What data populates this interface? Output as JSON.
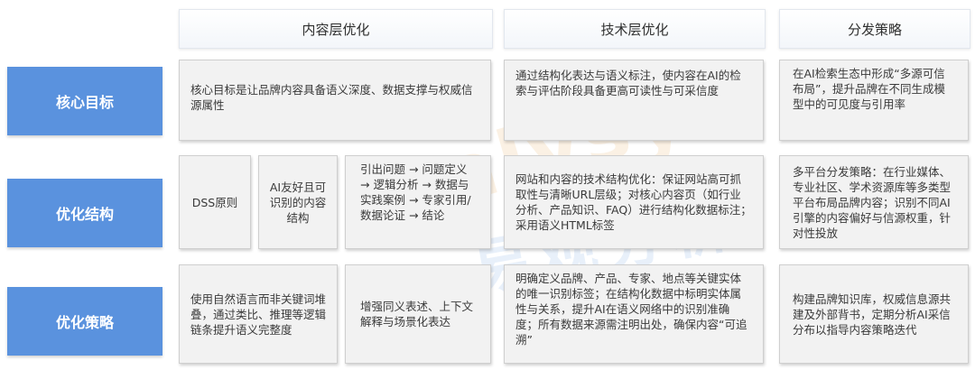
{
  "headers": [
    "内容层优化",
    "技术层优化",
    "分发策略"
  ],
  "rows": [
    {
      "label": "核心目标",
      "content": "核心目标是让品牌内容具备语义深度、数据支撑与权威信源属性",
      "tech": "通过结构化表达与语义标注，使内容在AI的检索与评估阶段具备更高可读性与可采信度",
      "dist": "在AI检索生态中形成“多源可信布局”，提升品牌在不同生成模型中的可见度与引用率"
    },
    {
      "label": "优化结构",
      "content_parts": [
        "DSS原则",
        "AI友好且可识别的内容结构",
        "引出问题 → 问题定义 → 逻辑分析 → 数据与实践案例 → 专家引用/数据论证 → 结论"
      ],
      "tech": "网站和内容的技术结构优化：保证网站高可抓取性与清晰URL层级；对核心内容页（如行业分析、产品知识、FAQ）进行结构化数据标注；采用语义HTML标签",
      "dist": "多平台分发策略：在行业媒体、专业社区、学术资源库等多类型平台布局品牌内容；识别不同AI引擎的内容偏好与信源权重，针对性投放"
    },
    {
      "label": "优化策略",
      "content_parts": [
        "使用自然语言而非关键词堆叠，通过类比、推理等逻辑链条提升语义完整度",
        "增强同义表述、上下文解释与场景化表达"
      ],
      "tech": "明确定义品牌、产品、专家、地点等关键实体的唯一识别标签；在结构化数据中标明实体属性与关系，提升AI在语义网络中的识别准确度；所有数据来源需注明出处，确保内容“可追溯”",
      "dist": "构建品牌知识库，权威信息源共建及外部背书，定期分析AI采信分布以指导内容策略迭代"
    }
  ],
  "watermark": {
    "top": "nalysys",
    "bottom": "易观分析"
  },
  "colors": {
    "row_label_bg": "#5a92de",
    "cell_bg": "#f2f2f2",
    "header_bg": "#f3f6fa"
  }
}
